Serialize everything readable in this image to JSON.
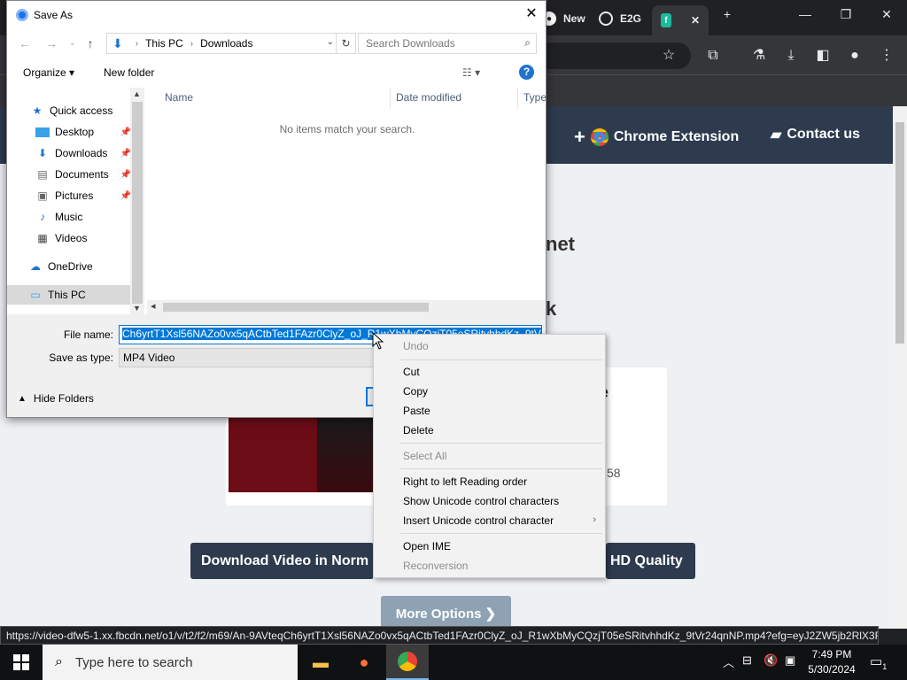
{
  "browser": {
    "tabs": [
      {
        "label": "New"
      },
      {
        "label": "E2G"
      },
      {
        "label": ""
      }
    ],
    "new_tab_symbol": "+",
    "window_controls": {
      "minimize": "—",
      "restore": "❐",
      "close": "✕"
    },
    "status_url": "https://video-dfw5-1.xx.fbcdn.net/o1/v/t2/f2/m69/An-9AVteqCh6yrtT1Xsl56NAZo0vx5qACtbTed1FAzr0ClyZ_oJ_R1wXbMyCQzjT05eSRitvhhdKz_9tVr24qnNP.mp4?efg=eyJ2ZW5jb2RlX3R..."
  },
  "website": {
    "nav": {
      "chrome_extension": "Chrome Extension",
      "contact_us": "Contact us"
    },
    "heading_fragment_1": "net",
    "heading_fragment_2": "k",
    "card_fragment_title": "e",
    "card_fragment_duration": "58",
    "download_normal_label": "Download Video in Norm",
    "download_hd_label": "HD Quality",
    "more_options_label": "More Options ❯"
  },
  "dialog": {
    "title": "Save As",
    "breadcrumb": [
      "This PC",
      "Downloads"
    ],
    "search_placeholder": "Search Downloads",
    "organize_label": "Organize ▾",
    "new_folder_label": "New folder",
    "help_label": "?",
    "nav_items": [
      {
        "label": "Quick access",
        "icon": "star-icon"
      },
      {
        "label": "Desktop",
        "icon": "desktop-icon",
        "pinned": true
      },
      {
        "label": "Downloads",
        "icon": "download-icon",
        "pinned": true
      },
      {
        "label": "Documents",
        "icon": "document-icon",
        "pinned": true
      },
      {
        "label": "Pictures",
        "icon": "pictures-icon",
        "pinned": true
      },
      {
        "label": "Music",
        "icon": "music-icon"
      },
      {
        "label": "Videos",
        "icon": "videos-icon"
      },
      {
        "label": "OneDrive",
        "icon": "cloud-icon"
      },
      {
        "label": "This PC",
        "icon": "pc-icon",
        "selected": true
      }
    ],
    "columns": [
      "Name",
      "Date modified",
      "Type"
    ],
    "empty_message": "No items match your search.",
    "file_name_label": "File name:",
    "file_name_value": "Ch6yrtT1Xsl56NAZo0vx5qACtbTed1FAzr0ClyZ_oJ_R1wXbMyCQzjT05eSRitvhhdKz_9tVr2",
    "save_type_label": "Save as type:",
    "save_type_value": "MP4 Video",
    "hide_folders_label": "Hide Folders"
  },
  "context_menu": {
    "items": [
      {
        "label": "Undo",
        "disabled": true
      },
      {
        "label": "Cut"
      },
      {
        "label": "Copy"
      },
      {
        "label": "Paste"
      },
      {
        "label": "Delete"
      },
      {
        "label": "Select All",
        "disabled": true
      },
      {
        "label": "Right to left Reading order"
      },
      {
        "label": "Show Unicode control characters"
      },
      {
        "label": "Insert Unicode control character",
        "submenu": true
      },
      {
        "label": "Open IME"
      },
      {
        "label": "Reconversion",
        "disabled": true
      }
    ]
  },
  "taskbar": {
    "search_placeholder": "Type here to search",
    "time": "7:49 PM",
    "date": "5/30/2024",
    "notification_count": "1"
  },
  "colors": {
    "accent": "#0078d7",
    "site_header": "#2e3b4e",
    "chrome_dark": "#202124"
  }
}
